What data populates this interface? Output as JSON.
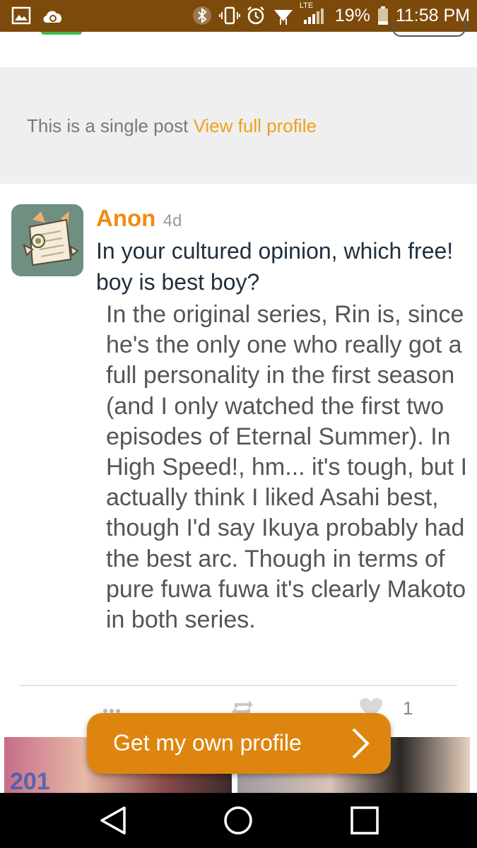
{
  "status_bar": {
    "battery": "19%",
    "time": "11:58 PM",
    "network_badge": "LTE",
    "icons": [
      "gallery-icon",
      "cloud-sync-icon",
      "bluetooth-icon",
      "vibrate-icon",
      "alarm-icon",
      "wifi-icon",
      "signal-icon",
      "battery-icon"
    ]
  },
  "banner": {
    "text": "This is a single post",
    "link": "View full profile"
  },
  "post": {
    "author": "Anon",
    "age": "4d",
    "question": "In your cultured opinion, which free! boy is best boy?",
    "answer": "In the original series, Rin is, since he's the only one who really got a full personality in the first season (and I only watched the first two episodes of Eternal Summer). In High Speed!, hm... it's tough, but I actually think I liked Asahi best, though I'd say Ikuya probably had the best arc. Though in terms of pure fuwa fuwa it's clearly Makoto in both series.",
    "likes": "1"
  },
  "next_post": {
    "image_text": "201"
  },
  "cta": {
    "label": "Get my own profile"
  },
  "nav": {
    "icons": [
      "back-icon",
      "home-icon",
      "recents-icon"
    ]
  },
  "colors": {
    "status_bar": "#7c4a0b",
    "accent": "#f08c14",
    "cta": "#dd850f",
    "banner_bg": "#efefef"
  }
}
